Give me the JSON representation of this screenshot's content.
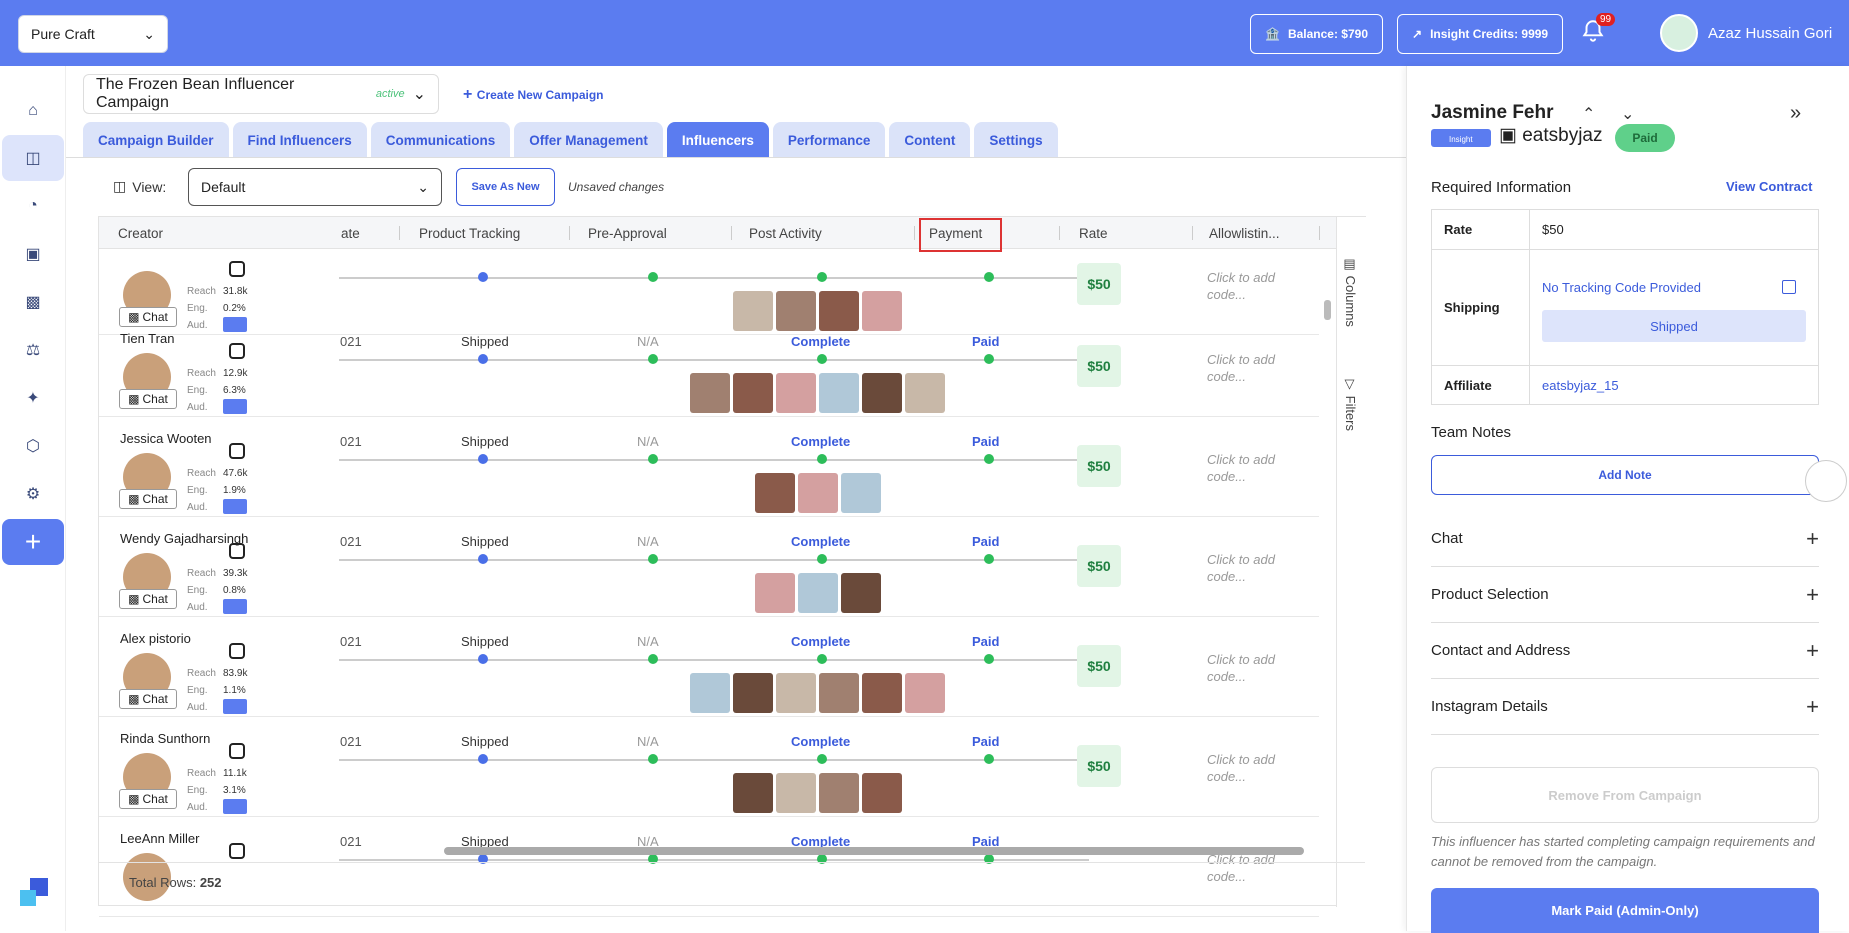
{
  "topbar": {
    "brand": "Pure Craft",
    "balance": "Balance: $790",
    "insight_credits": "Insight Credits: 9999",
    "notif_count": "99",
    "user_name": "Azaz Hussain Gori"
  },
  "campaign": {
    "name": "The Frozen Bean Influencer Campaign",
    "status": "active",
    "create_new": "Create New Campaign"
  },
  "tabs": [
    "Campaign Builder",
    "Find Influencers",
    "Communications",
    "Offer Management",
    "Influencers",
    "Performance",
    "Content",
    "Settings"
  ],
  "view": {
    "label": "View:",
    "selected": "Default",
    "save_as_new": "Save As New",
    "unsaved": "Unsaved changes"
  },
  "columns": {
    "creator": "Creator",
    "date_frag": "ate",
    "product_tracking": "Product Tracking",
    "pre_approval": "Pre-Approval",
    "post_activity": "Post Activity",
    "payment": "Payment",
    "rate": "Rate",
    "allowlisting": "Allowlistin..."
  },
  "stat_labels": {
    "reach": "Reach",
    "eng": "Eng.",
    "aud": "Aud.",
    "chat": "Chat"
  },
  "cell_text": {
    "year_frag": "021",
    "shipped": "Shipped",
    "na": "N/A",
    "complete": "Complete",
    "paid": "Paid",
    "add_code_1": "Click to add",
    "add_code_2": "code..."
  },
  "rows": [
    {
      "name": "",
      "reach": "31.8k",
      "eng": "0.2%",
      "rate": "$50",
      "thumbs": 4
    },
    {
      "name": "Tien Tran",
      "reach": "12.9k",
      "eng": "6.3%",
      "rate": "$50",
      "thumbs": 6
    },
    {
      "name": "Jessica Wooten",
      "reach": "47.6k",
      "eng": "1.9%",
      "rate": "$50",
      "thumbs": 3
    },
    {
      "name": "Wendy Gajadharsingh",
      "reach": "39.3k",
      "eng": "0.8%",
      "rate": "$50",
      "thumbs": 3
    },
    {
      "name": "Alex pistorio",
      "reach": "83.9k",
      "eng": "1.1%",
      "rate": "$50",
      "thumbs": 6
    },
    {
      "name": "Rinda Sunthorn",
      "reach": "11.1k",
      "eng": "3.1%",
      "rate": "$50",
      "thumbs": 4
    },
    {
      "name": "LeeAnn Miller",
      "reach": "",
      "eng": "",
      "rate": "",
      "thumbs": 0
    }
  ],
  "side_toggles": {
    "columns": "Columns",
    "filters": "Filters"
  },
  "footer": {
    "total_label": "Total Rows:",
    "total_value": "252"
  },
  "panel": {
    "name": "Jasmine Fehr",
    "insight": "Insight",
    "handle": "eatsbyjaz",
    "paid_badge": "Paid",
    "required_info": "Required Information",
    "view_contract": "View Contract",
    "rate_label": "Rate",
    "rate_value": "$50",
    "shipping_label": "Shipping",
    "no_tracking": "No Tracking Code Provided",
    "shipped": "Shipped",
    "affiliate_label": "Affiliate",
    "affiliate_value": "eatsbyjaz_15",
    "team_notes": "Team Notes",
    "add_note": "Add Note",
    "accordions": [
      "Chat",
      "Product Selection",
      "Contact and Address",
      "Instagram Details"
    ],
    "remove": "Remove From Campaign",
    "remove_note": "This influencer has started completing campaign requirements and cannot be removed from the campaign.",
    "mark_paid": "Mark Paid (Admin-Only)"
  },
  "colors": {
    "accent": "#5b7cf0",
    "success": "#2dbd5a",
    "link": "#3b5bdb"
  }
}
